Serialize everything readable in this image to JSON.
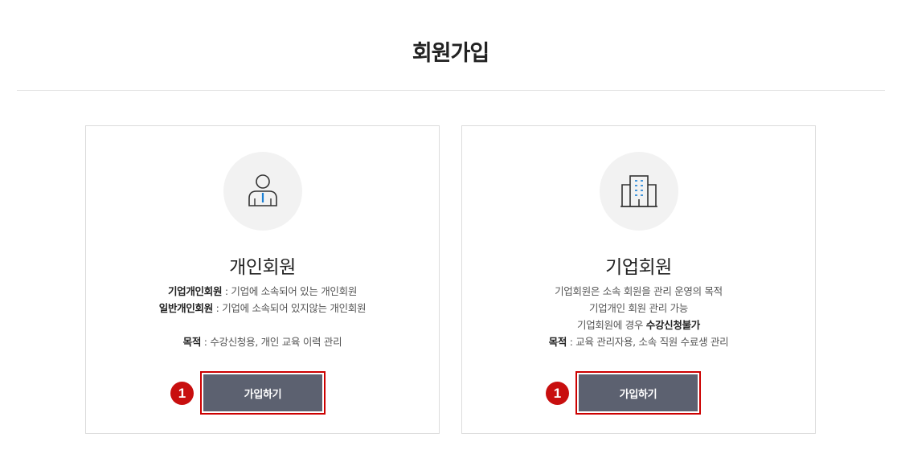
{
  "page": {
    "title": "회원가입"
  },
  "personal": {
    "title": "개인회원",
    "lines": [
      {
        "bold": "기업개인회원",
        "text": " : 기업에 소속되어 있는 개인회원"
      },
      {
        "bold": "일반개인회원",
        "text": " : 기업에 소속되어 있지않는 개인회원"
      },
      {
        "bold": "목적",
        "text": " : 수강신청용, 개인 교육 이력 관리"
      }
    ],
    "button_label": "가입하기",
    "badge": "1",
    "icon": "person-icon"
  },
  "corporate": {
    "title": "기업회원",
    "lines": [
      {
        "text": "기업회원은 소속 회원을 관리 운영의 목적"
      },
      {
        "text": "기업개인 회원 관리 가능"
      },
      {
        "text": "기업회원에 경우 ",
        "bold": "수강신청불가"
      },
      {
        "bold": "목적",
        "text": " : 교육 관리자용, 소속 직원 수료생 관리"
      }
    ],
    "button_label": "가입하기",
    "badge": "1",
    "icon": "building-icon"
  },
  "colors": {
    "button": "#5c6170",
    "highlight": "#cc0000",
    "badge": "#c80f0f",
    "icon_accent": "#1a7fd4"
  }
}
